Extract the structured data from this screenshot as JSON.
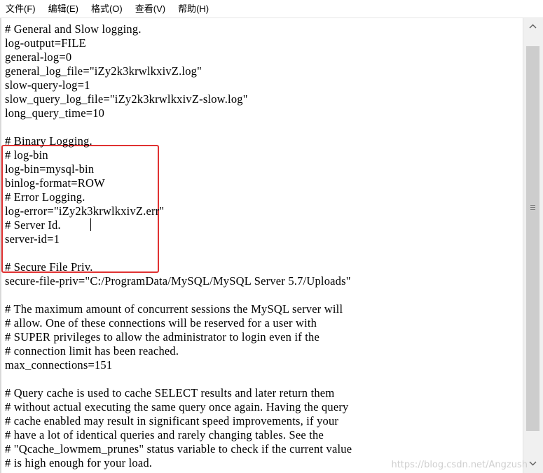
{
  "menu": {
    "file": "文件(F)",
    "edit": "编辑(E)",
    "format": "格式(O)",
    "view": "查看(V)",
    "help": "帮助(H)"
  },
  "editor": {
    "lines": [
      "# General and Slow logging.",
      "log-output=FILE",
      "general-log=0",
      "general_log_file=\"iZy2k3krwlkxivZ.log\"",
      "slow-query-log=1",
      "slow_query_log_file=\"iZy2k3krwlkxivZ-slow.log\"",
      "long_query_time=10",
      "",
      "# Binary Logging.",
      "# log-bin",
      "log-bin=mysql-bin",
      "binlog-format=ROW",
      "# Error Logging.",
      "log-error=\"iZy2k3krwlkxivZ.err\"",
      "# Server Id.",
      "server-id=1",
      "",
      "# Secure File Priv.",
      "secure-file-priv=\"C:/ProgramData/MySQL/MySQL Server 5.7/Uploads\"",
      "",
      "# The maximum amount of concurrent sessions the MySQL server will",
      "# allow. One of these connections will be reserved for a user with",
      "# SUPER privileges to allow the administrator to login even if the",
      "# connection limit has been reached.",
      "max_connections=151",
      "",
      "# Query cache is used to cache SELECT results and later return them",
      "# without actual executing the same query once again. Having the query",
      "# cache enabled may result in significant speed improvements, if your",
      "# have a lot of identical queries and rarely changing tables. See the",
      "# \"Qcache_lowmem_prunes\" status variable to check if the current value",
      "# is high enough for your load."
    ]
  },
  "watermark": "https://blog.csdn.net/Angzush",
  "colors": {
    "highlight_box": "#e03131",
    "background": "#ffffff",
    "scrollbar_track": "#f0f0f0"
  },
  "icons": {
    "scroll_up": "chevron-up-icon",
    "scroll_down": "chevron-down-icon"
  }
}
